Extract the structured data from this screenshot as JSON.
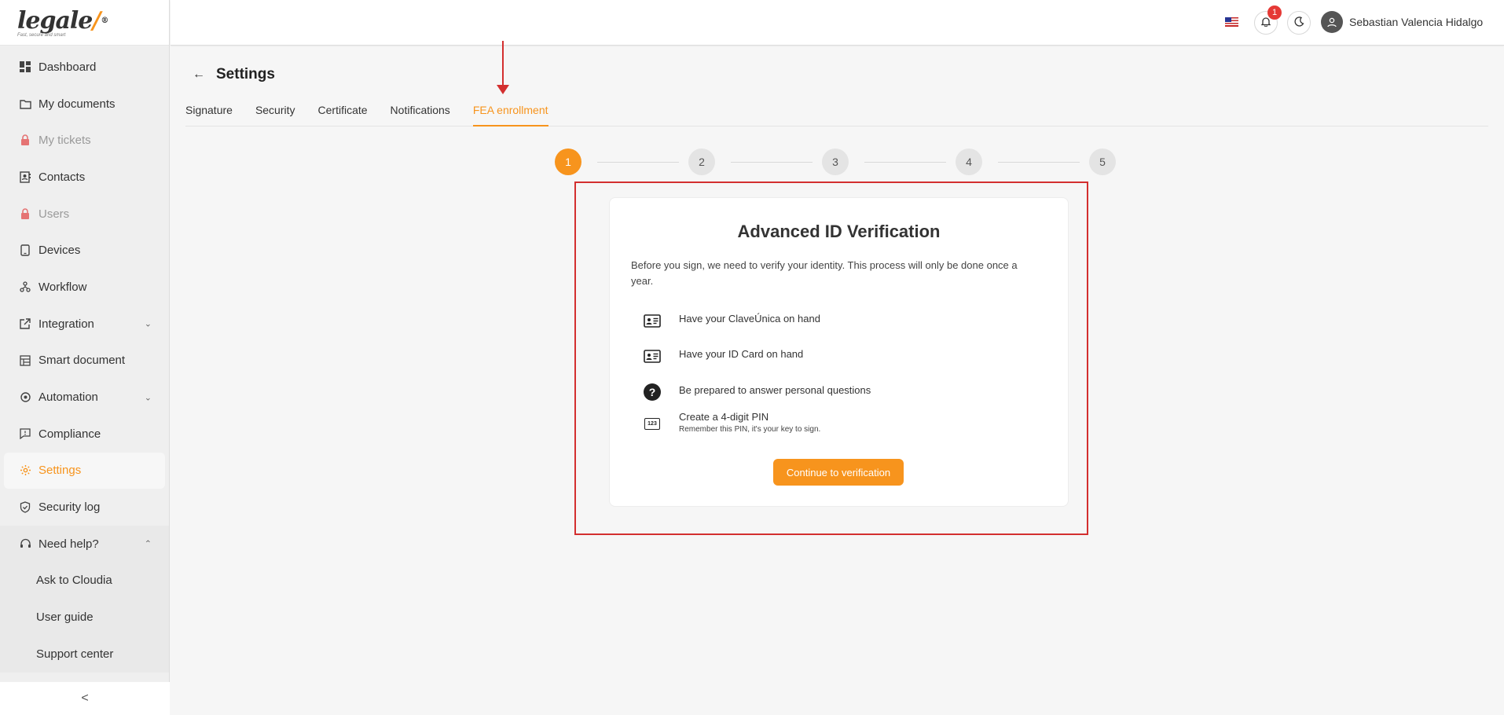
{
  "brand": {
    "logo_text": "legale",
    "tagline": "Fast, secure and smart",
    "accent_color": "#f7941d"
  },
  "sidebar": {
    "items": [
      {
        "label": "Dashboard",
        "icon": "dashboard-icon"
      },
      {
        "label": "My documents",
        "icon": "folder-icon"
      },
      {
        "label": "My tickets",
        "icon": "lock-icon",
        "disabled": true
      },
      {
        "label": "Contacts",
        "icon": "contacts-icon"
      },
      {
        "label": "Users",
        "icon": "lock-icon",
        "disabled": true
      },
      {
        "label": "Devices",
        "icon": "tablet-icon"
      },
      {
        "label": "Workflow",
        "icon": "workflow-icon"
      },
      {
        "label": "Integration",
        "icon": "external-link-icon",
        "expandable": true
      },
      {
        "label": "Smart document",
        "icon": "smart-document-icon"
      },
      {
        "label": "Automation",
        "icon": "automation-icon",
        "expandable": true
      },
      {
        "label": "Compliance",
        "icon": "compliance-icon"
      },
      {
        "label": "Settings",
        "icon": "gear-icon",
        "active": true
      },
      {
        "label": "Security log",
        "icon": "shield-icon"
      }
    ],
    "help": {
      "label": "Need help?",
      "subitems": [
        "Ask to Cloudia",
        "User guide",
        "Support center"
      ]
    },
    "collapse_symbol": "<"
  },
  "header": {
    "notification_count": "1",
    "user_name": "Sebastian Valencia Hidalgo"
  },
  "page": {
    "title": "Settings",
    "tabs": [
      "Signature",
      "Security",
      "Certificate",
      "Notifications",
      "FEA enrollment"
    ],
    "active_tab": 4
  },
  "stepper": {
    "steps": [
      "1",
      "2",
      "3",
      "4",
      "5"
    ],
    "current": 1
  },
  "card": {
    "title": "Advanced ID Verification",
    "intro": "Before you sign, we need to verify your identity. This process will only be done once a year.",
    "requirements": [
      {
        "text": "Have your ClaveÚnica on hand",
        "icon": "id-card-icon"
      },
      {
        "text": "Have your ID Card on hand",
        "icon": "id-card-icon"
      },
      {
        "text": "Be prepared to answer personal questions",
        "icon": "question-icon"
      },
      {
        "text": "Create a 4-digit PIN",
        "subtext": "Remember this PIN, it's your key to sign.",
        "icon": "pin-icon",
        "icon_text": "123"
      }
    ],
    "cta_label": "Continue to verification"
  }
}
